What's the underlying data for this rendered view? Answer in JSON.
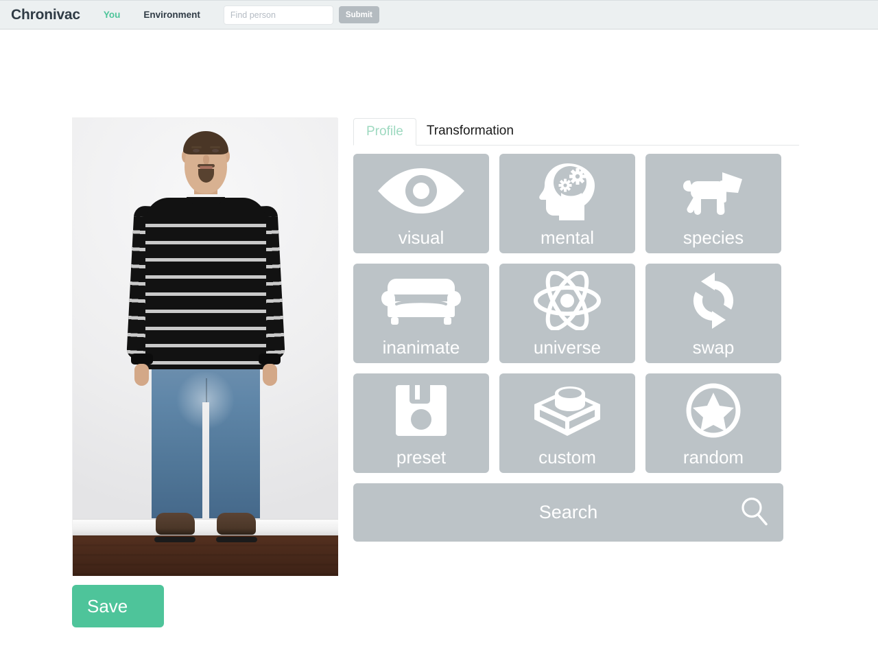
{
  "navbar": {
    "brand": "Chronivac",
    "links": [
      {
        "label": "You",
        "name": "nav-link-you"
      },
      {
        "label": "Environment",
        "name": "nav-link-environment"
      }
    ],
    "search": {
      "placeholder": "Find person",
      "value": "",
      "submit_label": "Submit"
    },
    "colors": {
      "background": "#ecf0f1",
      "accent_green": "#4ec49a",
      "submit_button": "#b4bbc0"
    }
  },
  "left_panel": {
    "photo_alt": "Full body photo of a man standing against a white wall, wearing a black sweater with white horizontal stripes, blue jeans and brown boots",
    "save_label": "Save",
    "save_color": "#4ec49a"
  },
  "right_panel": {
    "tabs": [
      {
        "label": "Profile",
        "active": true,
        "name": "tab-profile"
      },
      {
        "label": "Transformation",
        "active": false,
        "name": "tab-transformation"
      }
    ],
    "tiles": [
      {
        "label": "visual",
        "icon": "eye-icon",
        "name": "tile-visual"
      },
      {
        "label": "mental",
        "icon": "head-gears-icon",
        "name": "tile-mental"
      },
      {
        "label": "species",
        "icon": "dog-icon",
        "name": "tile-species"
      },
      {
        "label": "inanimate",
        "icon": "couch-icon",
        "name": "tile-inanimate"
      },
      {
        "label": "universe",
        "icon": "atom-icon",
        "name": "tile-universe"
      },
      {
        "label": "swap",
        "icon": "swap-arrows-icon",
        "name": "tile-swap"
      },
      {
        "label": "preset",
        "icon": "floppy-disk-icon",
        "name": "tile-preset"
      },
      {
        "label": "custom",
        "icon": "lego-brick-icon",
        "name": "tile-custom"
      },
      {
        "label": "random",
        "icon": "star-circle-icon",
        "name": "tile-random"
      }
    ],
    "search_bar": {
      "label": "Search",
      "icon": "magnifier-icon"
    },
    "colors": {
      "tile_background": "#bcc3c7",
      "tile_text": "#ffffff",
      "active_tab_text": "#9ed9c0"
    }
  }
}
